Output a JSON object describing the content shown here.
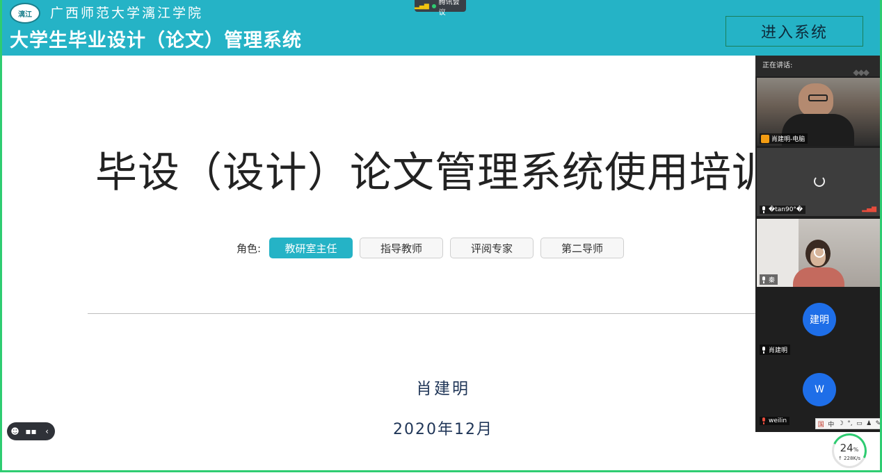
{
  "meeting": {
    "app_name": "腾讯会议",
    "signal_glyph": "▂▄▆"
  },
  "header": {
    "logo_text": "漓江",
    "school_name": "广西师范大学漓江学院",
    "system_title": "大学生毕业设计（论文）管理系统",
    "enter_button": "进入系统"
  },
  "slide": {
    "title": "毕设（设计）论文管理系统使用培训",
    "role_label": "角色:",
    "roles": [
      {
        "label": "教研室主任",
        "active": true
      },
      {
        "label": "指导教师",
        "active": false
      },
      {
        "label": "评阅专家",
        "active": false
      },
      {
        "label": "第二导师",
        "active": false
      }
    ],
    "presenter": "肖建明",
    "date": "2020年12月"
  },
  "controls": {
    "emoji_icon": "☻",
    "chat_icon": "▪▪",
    "collapse_icon": "‹"
  },
  "video_panel": {
    "speaking_label": "正在讲话:",
    "participants": [
      {
        "name": "肖建明-电脑",
        "icon": "camera"
      },
      {
        "name": "�tan90°�",
        "icon": "mic"
      },
      {
        "name": "秦",
        "icon": "mic"
      },
      {
        "name": "肖建明",
        "icon": "mic",
        "avatar_text": "建明"
      },
      {
        "name": "weilin",
        "icon": "mic-muted",
        "avatar_text": "W"
      }
    ]
  },
  "ime_toolbar": {
    "items": [
      "国",
      "中",
      "☽",
      "°,",
      "▭",
      "♟",
      "✎"
    ]
  },
  "network": {
    "percent": "24",
    "percent_unit": "%",
    "speed": "↑ 228K/s"
  },
  "colors": {
    "header": "#25b3c6",
    "active_role": "#25b3c6",
    "text_dark": "#1f3557",
    "avatar": "#1e6ee8",
    "share_border": "#2ecc71"
  }
}
